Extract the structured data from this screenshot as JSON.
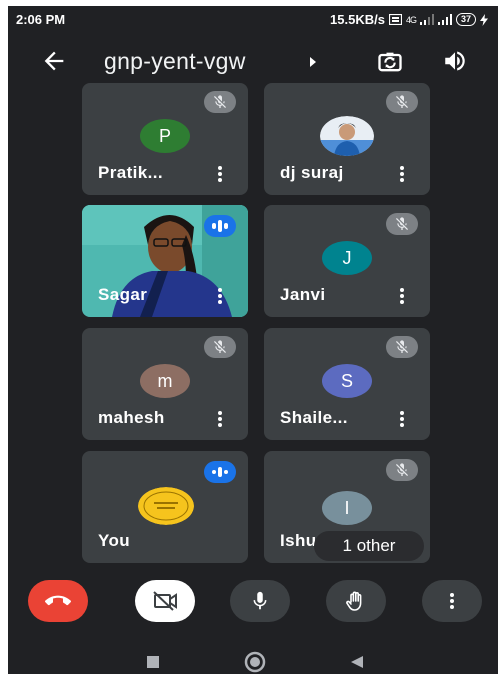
{
  "status_bar": {
    "time": "2:06 PM",
    "network_speed": "15.5KB/s",
    "network_type": "4G",
    "battery_level": "37"
  },
  "header": {
    "meeting_code": "gnp-yent-vgw",
    "icons": [
      "back-arrow-icon",
      "caret-right-icon",
      "switch-camera-icon",
      "speaker-icon"
    ]
  },
  "participants": [
    {
      "name": "Pratik...",
      "avatar_letter": "P",
      "avatar_color": "#2e7d32",
      "muted": true
    },
    {
      "name": "dj suraj",
      "avatar_type": "photo",
      "muted": true
    },
    {
      "name": "Sagar",
      "avatar_type": "video",
      "speaking": true
    },
    {
      "name": "Janvi",
      "avatar_letter": "J",
      "avatar_color": "#00838f",
      "muted": true
    },
    {
      "name": "mahesh",
      "avatar_letter": "m",
      "avatar_color": "#8d6e63",
      "muted": true
    },
    {
      "name": "Shaile...",
      "avatar_letter": "S",
      "avatar_color": "#5c6bc0",
      "muted": true
    },
    {
      "name": "You",
      "avatar_type": "logo",
      "speaking": true
    },
    {
      "name": "Ishu",
      "avatar_letter": "I",
      "avatar_color": "#78909c",
      "muted": true
    }
  ],
  "others_chip": "1 other",
  "controls": {
    "colors": {
      "end_call": "#ea4335",
      "camera_off": "#ffffff",
      "dark_button": "#3c4043"
    },
    "icons": [
      "end-call-icon",
      "camera-off-icon",
      "microphone-icon",
      "raise-hand-icon",
      "more-options-icon"
    ]
  },
  "nav_icons": [
    "recents-icon",
    "home-icon",
    "back-icon"
  ]
}
